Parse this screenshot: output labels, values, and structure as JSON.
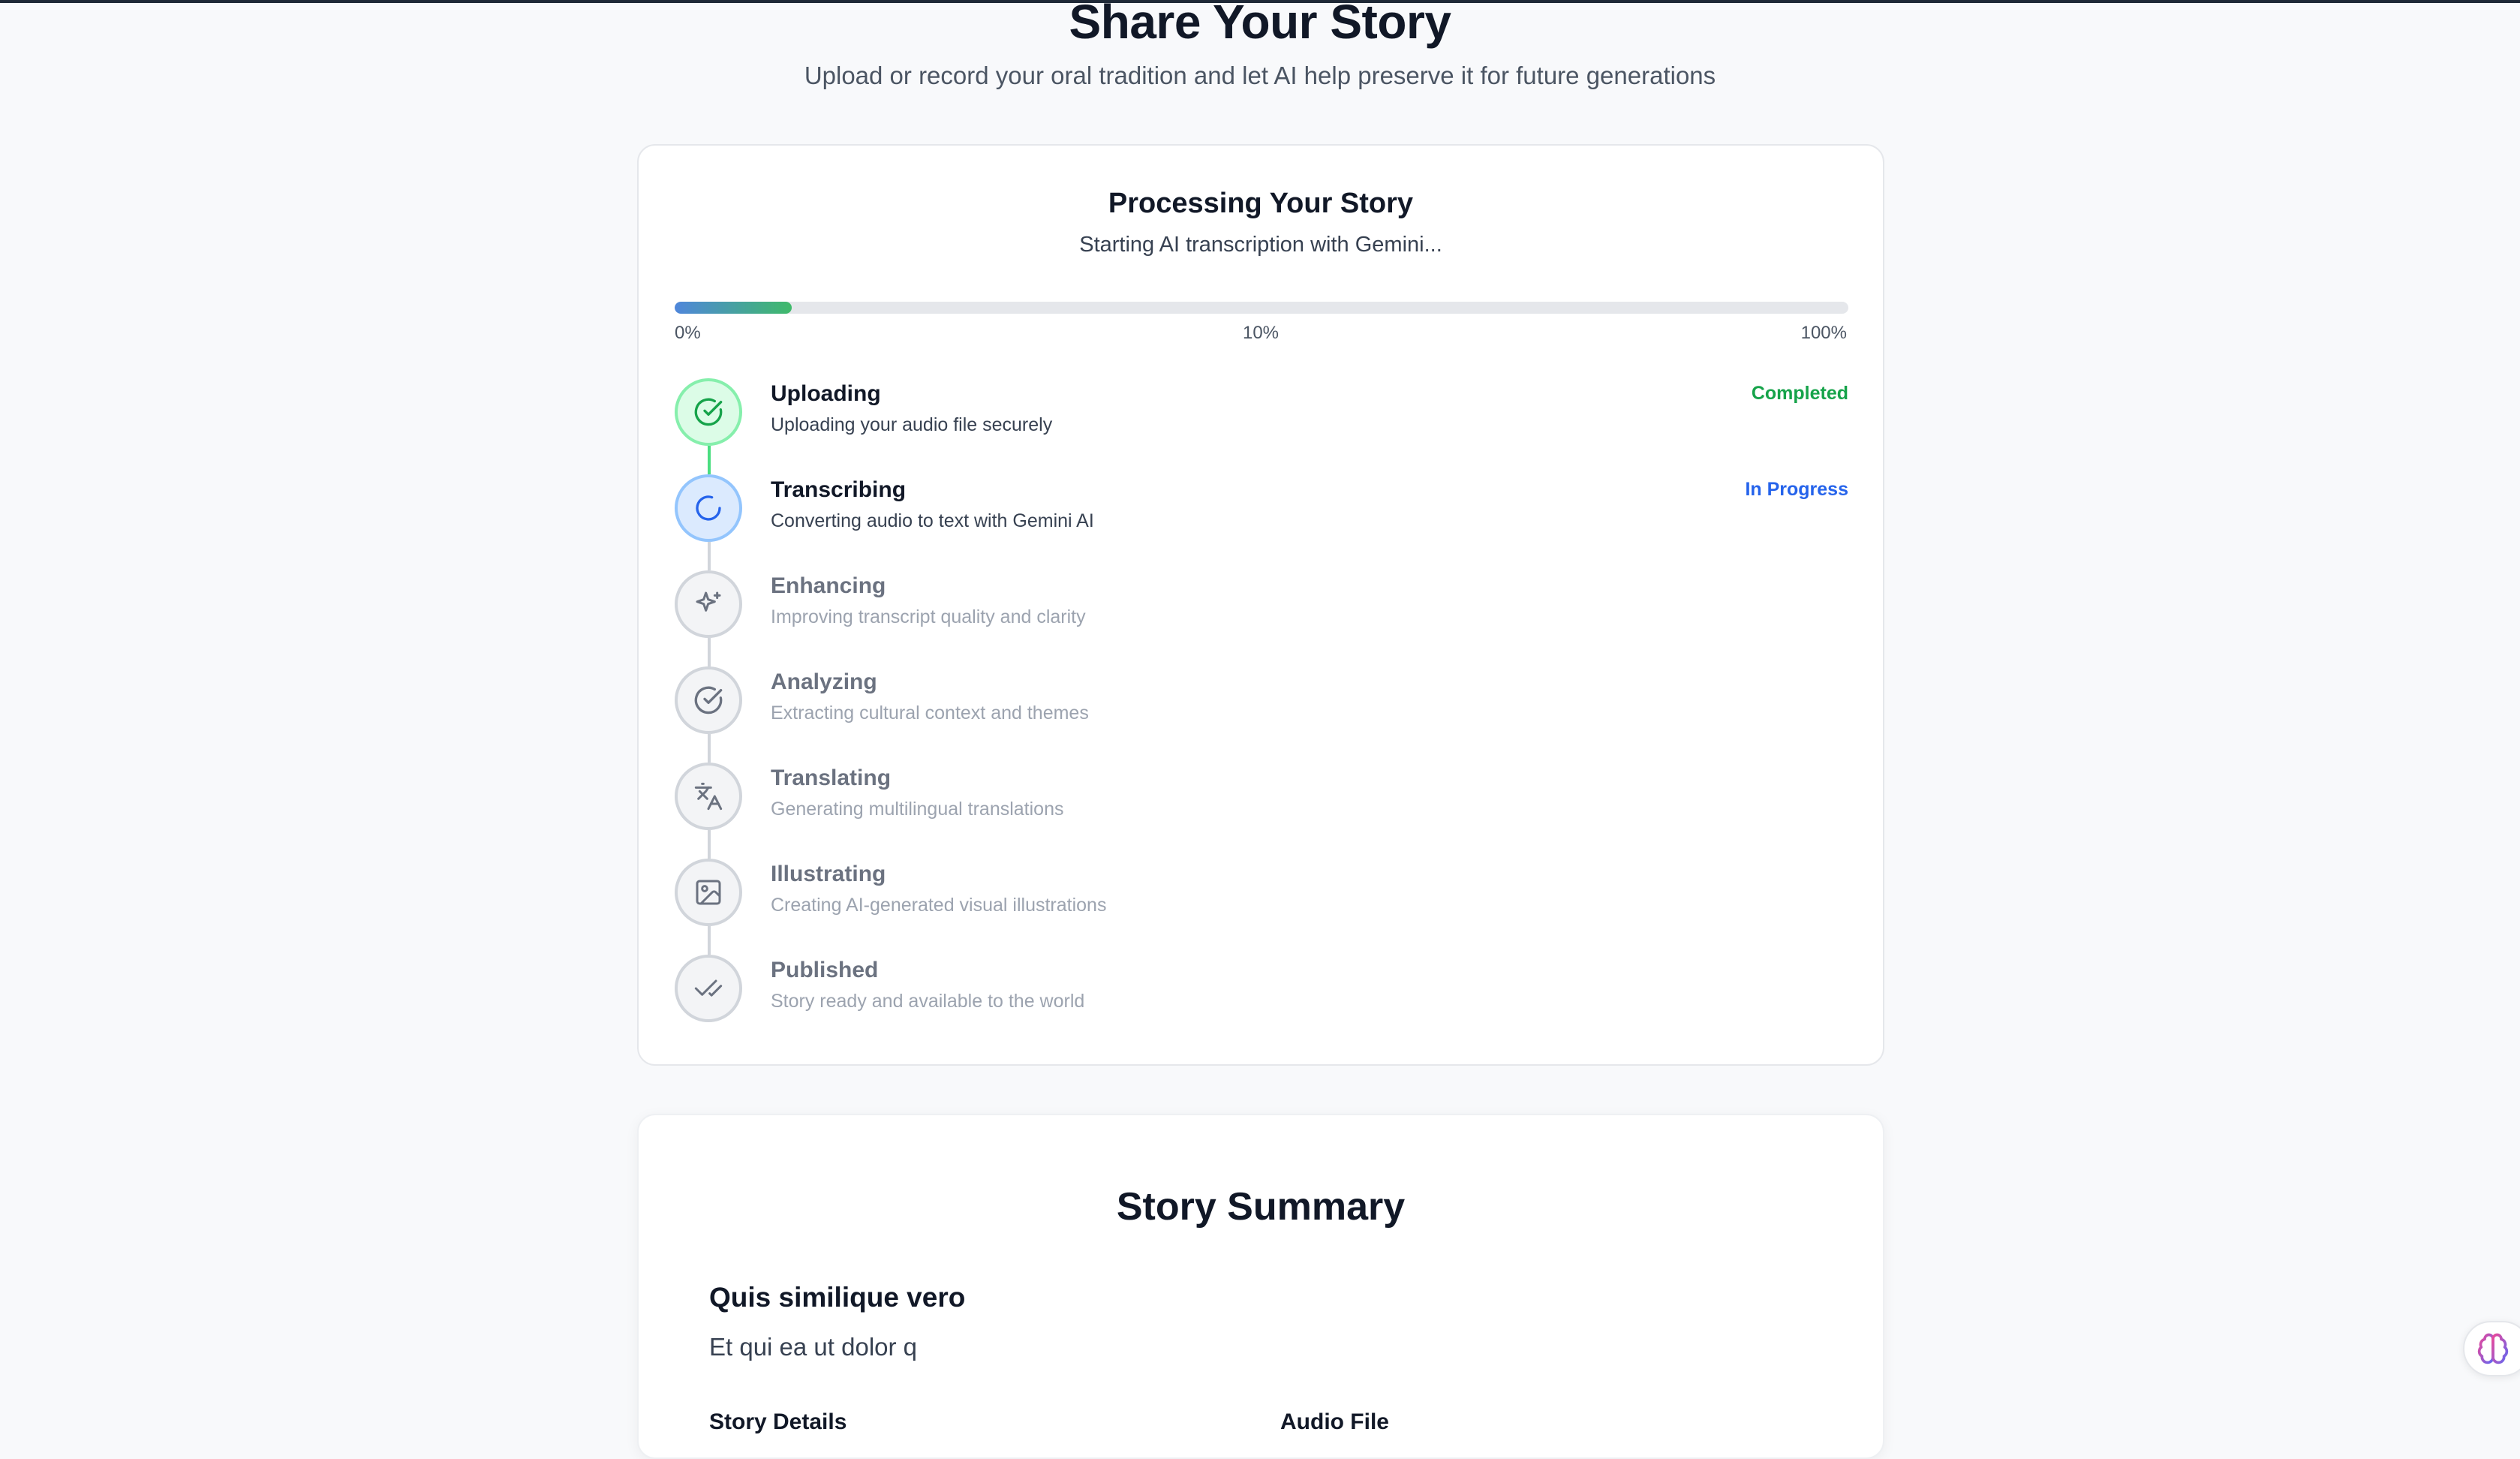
{
  "header": {
    "title": "Share Your Story",
    "subtitle": "Upload or record your oral tradition and let AI help preserve it for future generations"
  },
  "processing": {
    "title": "Processing Your Story",
    "status": "Starting AI transcription with Gemini...",
    "progress_fraction": 0.1,
    "progress_labels": {
      "start": "0%",
      "current": "10%",
      "end": "100%"
    },
    "steps": [
      {
        "name": "Uploading",
        "description": "Uploading your audio file securely",
        "status": "Completed",
        "icon": "check-circle-icon"
      },
      {
        "name": "Transcribing",
        "description": "Converting audio to text with Gemini AI",
        "status": "In Progress",
        "icon": "loader-icon"
      },
      {
        "name": "Enhancing",
        "description": "Improving transcript quality and clarity",
        "icon": "sparkles-icon"
      },
      {
        "name": "Analyzing",
        "description": "Extracting cultural context and themes",
        "icon": "check-circle-icon"
      },
      {
        "name": "Translating",
        "description": "Generating multilingual translations",
        "icon": "languages-icon"
      },
      {
        "name": "Illustrating",
        "description": "Creating AI-generated visual illustrations",
        "icon": "image-icon"
      },
      {
        "name": "Published",
        "description": "Story ready and available to the world",
        "icon": "check-check-icon"
      }
    ]
  },
  "summary": {
    "title": "Story Summary",
    "story_title": "Quis similique vero",
    "excerpt": "Et qui ea ut dolor q",
    "details_label": "Story Details",
    "audio_label": "Audio File"
  },
  "colors": {
    "completed": "#16a34a",
    "in_progress": "#2563eb",
    "progress_gradient_start": "#4f86db",
    "progress_gradient_end": "#3fba6a"
  },
  "floating_button_icon": "brain-icon"
}
